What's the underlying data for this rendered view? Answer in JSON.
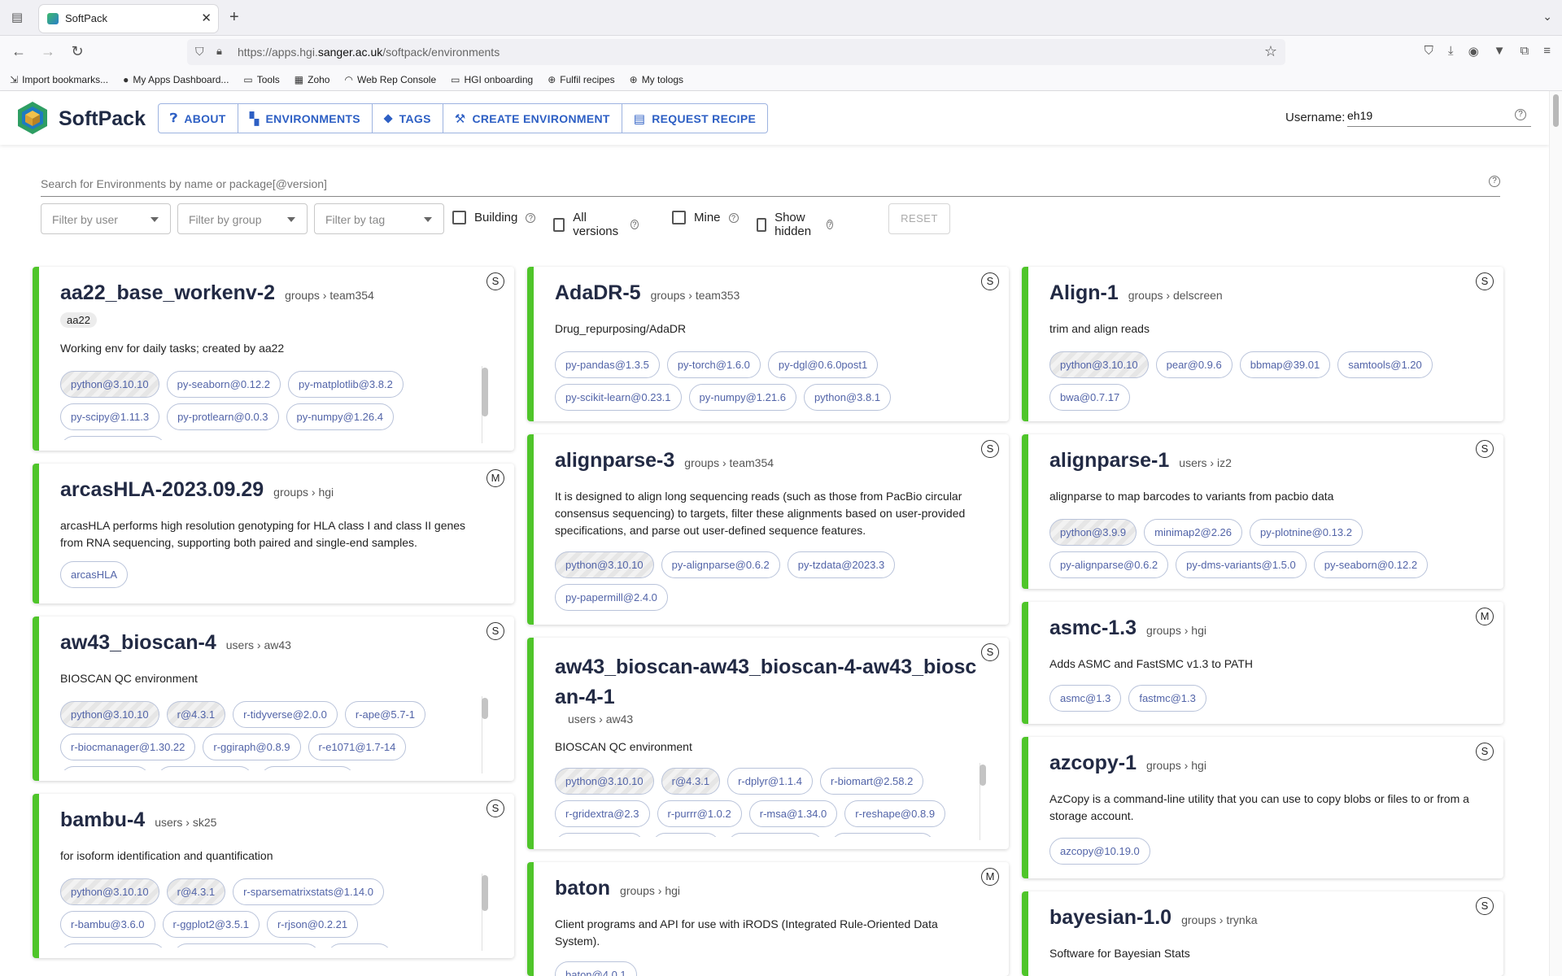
{
  "browser": {
    "tab_title": "SoftPack",
    "url_prefix": "https://apps.hgi.",
    "url_domain": "sanger.ac.uk",
    "url_path": "/softpack/environments",
    "bookmarks": [
      "Import bookmarks...",
      "My Apps Dashboard...",
      "Tools",
      "Zoho",
      "Web Rep Console",
      "HGI onboarding",
      "Fulfil recipes",
      "My tologs"
    ]
  },
  "header": {
    "brand": "SoftPack",
    "menu": [
      "ABOUT",
      "ENVIRONMENTS",
      "TAGS",
      "CREATE ENVIRONMENT",
      "REQUEST RECIPE"
    ],
    "username_label": "Username:",
    "username_value": "eh19"
  },
  "search": {
    "placeholder": "Search for Environments by name or package[@version]"
  },
  "filters": {
    "user": "Filter by user",
    "group": "Filter by group",
    "tag": "Filter by tag",
    "building": "Building",
    "all_versions": "All versions",
    "mine": "Mine",
    "show_hidden": "Show hidden",
    "reset": "RESET"
  },
  "cards": [
    {
      "name": "aa22_base_workenv-2",
      "scope": "groups",
      "owner": "team354",
      "badge": "S",
      "user_tag": "aa22",
      "desc": "Working env for daily tasks; created by aa22",
      "packages": [
        "python@3.10.10",
        "py-seaborn@0.12.2",
        "py-matplotlib@3.8.2",
        "py-scipy@1.11.3",
        "py-protlearn@0.0.3",
        "py-numpy@1.26.4"
      ]
    },
    {
      "name": "arcasHLA-2023.09.29",
      "scope": "groups",
      "owner": "hgi",
      "badge": "M",
      "desc": "arcasHLA performs high resolution genotyping for HLA class I and class II genes from RNA sequencing, supporting both paired and single-end samples.",
      "packages": [
        "arcasHLA"
      ]
    },
    {
      "name": "aw43_bioscan-4",
      "scope": "users",
      "owner": "aw43",
      "badge": "S",
      "desc": "BIOSCAN QC environment",
      "packages": [
        "python@3.10.10",
        "r@4.3.1",
        "r-tidyverse@2.0.0",
        "r-ape@5.7-1",
        "r-biocmanager@1.30.22",
        "r-ggiraph@0.8.9",
        "r-e1071@1.7-14"
      ]
    },
    {
      "name": "bambu-4",
      "scope": "users",
      "owner": "sk25",
      "badge": "S",
      "desc": "for isoform identification and quantification",
      "packages": [
        "python@3.10.10",
        "r@4.3.1",
        "r-sparsematrixstats@1.14.0",
        "r-bambu@3.6.0",
        "r-ggplot2@3.5.1",
        "r-rjson@0.2.21"
      ]
    },
    {
      "name": "AdaDR-5",
      "scope": "groups",
      "owner": "team353",
      "badge": "S",
      "desc": "Drug_repurposing/AdaDR",
      "packages": [
        "py-pandas@1.3.5",
        "py-torch@1.6.0",
        "py-dgl@0.6.0post1",
        "py-scikit-learn@0.23.1",
        "py-numpy@1.21.6",
        "python@3.8.1"
      ]
    },
    {
      "name": "alignparse-3",
      "scope": "groups",
      "owner": "team354",
      "badge": "S",
      "desc": "It is designed to align long sequencing reads (such as those from PacBio circular consensus sequencing) to targets, filter these alignments based on user-provided specifications, and parse out user-defined sequence features.",
      "packages": [
        "python@3.10.10",
        "py-alignparse@0.6.2",
        "py-tzdata@2023.3",
        "py-papermill@2.4.0"
      ]
    },
    {
      "name": "aw43_bioscan-aw43_bioscan-4-aw43_bioscan-4-1",
      "scope": "users",
      "owner": "aw43",
      "badge": "S",
      "desc": "BIOSCAN QC environment",
      "packages": [
        "python@3.10.10",
        "r@4.3.1",
        "r-dplyr@1.1.4",
        "r-biomart@2.58.2",
        "r-gridextra@2.3",
        "r-purrr@1.0.2",
        "r-msa@1.34.0",
        "r-reshape@0.8.9"
      ]
    },
    {
      "name": "baton",
      "scope": "groups",
      "owner": "hgi",
      "badge": "M",
      "desc": "Client programs and API for use with iRODS (Integrated Rule-Oriented Data System).",
      "packages": [
        "baton@4.0.1"
      ]
    },
    {
      "name": "Align-1",
      "scope": "groups",
      "owner": "delscreen",
      "badge": "S",
      "desc": "trim and align reads",
      "packages": [
        "python@3.10.10",
        "pear@0.9.6",
        "bbmap@39.01",
        "samtools@1.20",
        "bwa@0.7.17"
      ]
    },
    {
      "name": "alignparse-1",
      "scope": "users",
      "owner": "iz2",
      "badge": "S",
      "desc": "alignparse to map barcodes to variants from pacbio data",
      "packages": [
        "python@3.9.9",
        "minimap2@2.26",
        "py-plotnine@0.13.2",
        "py-alignparse@0.6.2",
        "py-dms-variants@1.5.0",
        "py-seaborn@0.12.2"
      ]
    },
    {
      "name": "asmc-1.3",
      "scope": "groups",
      "owner": "hgi",
      "badge": "M",
      "desc": "Adds ASMC and FastSMC v1.3 to PATH",
      "packages": [
        "asmc@1.3",
        "fastmc@1.3"
      ]
    },
    {
      "name": "azcopy-1",
      "scope": "groups",
      "owner": "hgi",
      "badge": "S",
      "desc": "AzCopy is a command-line utility that you can use to copy blobs or files to or from a storage account.",
      "packages": [
        "azcopy@10.19.0"
      ]
    },
    {
      "name": "bayesian-1.0",
      "scope": "groups",
      "owner": "trynka",
      "badge": "S",
      "desc": "Software for Bayesian Stats",
      "packages": []
    }
  ]
}
